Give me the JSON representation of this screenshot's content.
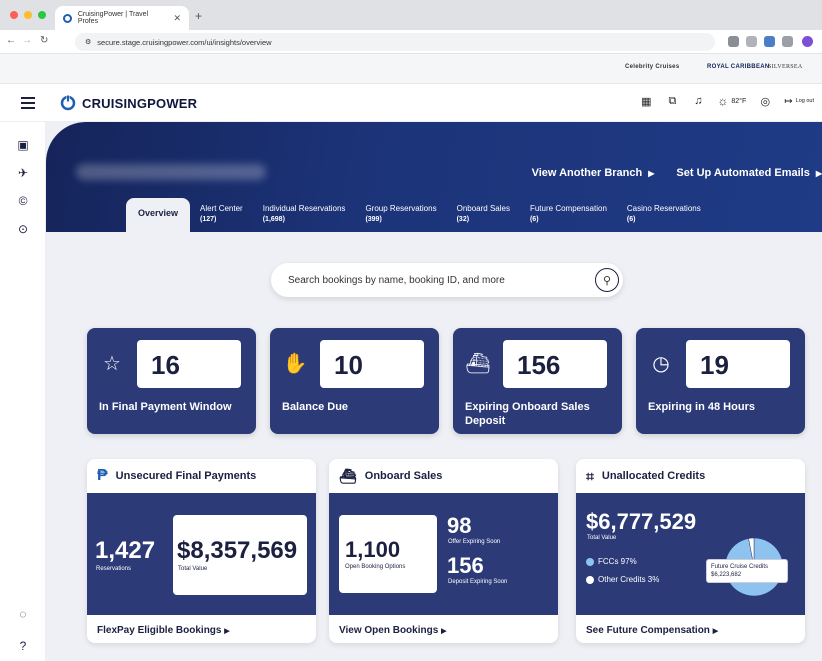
{
  "browser": {
    "tab_title": "CruisingPower | Travel Profes",
    "url": "secure.stage.cruisingpower.com/ui/insights/overview"
  },
  "brands": [
    "Celebrity Cruises",
    "ROYAL CARIBBEAN",
    "SILVERSEA"
  ],
  "header": {
    "logo": "CRUISINGPOWER",
    "temperature": "82°F",
    "logout": "Log out"
  },
  "hero": {
    "view_branch": "View Another Branch",
    "automated_emails": "Set Up Automated Emails"
  },
  "tabs": [
    {
      "label": "Overview",
      "count": ""
    },
    {
      "label": "Alert Center",
      "count": "(127)"
    },
    {
      "label": "Individual Reservations",
      "count": "(1,698)"
    },
    {
      "label": "Group Reservations",
      "count": "(399)"
    },
    {
      "label": "Onboard Sales",
      "count": "(32)"
    },
    {
      "label": "Future Compensation",
      "count": "(6)"
    },
    {
      "label": "Casino Reservations",
      "count": "(6)"
    }
  ],
  "search": {
    "placeholder": "Search bookings by name, booking ID, and more"
  },
  "stats": [
    {
      "value": "16",
      "label": "In Final Payment Window",
      "icon": "calendar-star-icon"
    },
    {
      "value": "10",
      "label": "Balance Due",
      "icon": "hand-coins-icon"
    },
    {
      "value": "156",
      "label": "Expiring Onboard Sales Deposit",
      "icon": "ship-clock-icon"
    },
    {
      "value": "19",
      "label": "Expiring in 48 Hours",
      "icon": "clock-icon"
    }
  ],
  "cards": {
    "final_payments": {
      "title": "Unsecured Final Payments",
      "reservations": "1,427",
      "reservations_label": "Reservations",
      "total": "$8,357,569",
      "total_label": "Total Value",
      "link": "FlexPay Eligible Bookings"
    },
    "onboard": {
      "title": "Onboard Sales",
      "open": "1,100",
      "open_label": "Open Booking Options",
      "offer": "98",
      "offer_label": "Offer Expiring Soon",
      "deposit": "156",
      "deposit_label": "Deposit Expiring Soon",
      "link": "View Open Bookings"
    },
    "credits": {
      "title": "Unallocated Credits",
      "total": "$6,777,529",
      "total_label": "Total Value",
      "fcc_label": "FCCs 97%",
      "other_label": "Other Credits 3%",
      "tooltip_title": "Future Cruise Credits",
      "tooltip_value": "$6,223,682",
      "link": "See Future Compensation",
      "colors": {
        "fcc": "#8fc3ef",
        "other": "#ffffff"
      }
    }
  },
  "chart_data": {
    "type": "pie",
    "categories": [
      "FCCs",
      "Other Credits"
    ],
    "values": [
      97,
      3
    ]
  }
}
